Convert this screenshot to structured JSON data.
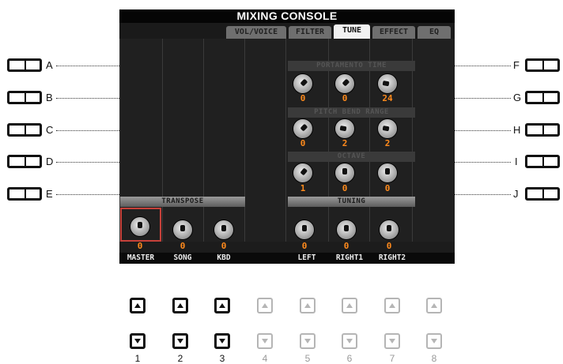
{
  "title": "MIXING CONSOLE",
  "tabs": [
    {
      "label": "VOL/VOICE",
      "active": false
    },
    {
      "label": "FILTER",
      "active": false
    },
    {
      "label": "TUNE",
      "active": true
    },
    {
      "label": "EFFECT",
      "active": false
    },
    {
      "label": "EQ",
      "active": false
    }
  ],
  "left_buttons": [
    {
      "label": "A"
    },
    {
      "label": "B"
    },
    {
      "label": "C"
    },
    {
      "label": "D"
    },
    {
      "label": "E"
    }
  ],
  "right_buttons": [
    {
      "label": "F"
    },
    {
      "label": "G"
    },
    {
      "label": "H"
    },
    {
      "label": "I"
    },
    {
      "label": "J"
    }
  ],
  "sections": {
    "transpose": "TRANSPOSE",
    "portamento": "PORTAMENTO TIME",
    "pitch_bend": "PITCH BEND RANGE",
    "octave": "OCTAVE",
    "tuning": "TUNING"
  },
  "transpose": {
    "master": "0",
    "song": "0",
    "kbd": "0"
  },
  "portamento": {
    "left": "0",
    "right1": "0",
    "right2": "24"
  },
  "pitch_bend": {
    "left": "0",
    "right1": "2",
    "right2": "2"
  },
  "octave": {
    "left": "1",
    "right1": "0",
    "right2": "0"
  },
  "tuning": {
    "left": "0",
    "right1": "0",
    "right2": "0"
  },
  "bottom_labels": [
    "MASTER",
    "SONG",
    "KBD",
    "",
    "LEFT",
    "RIGHT1",
    "RIGHT2",
    ""
  ],
  "number_buttons": [
    "1",
    "2",
    "3",
    "4",
    "5",
    "6",
    "7",
    "8"
  ],
  "colors": {
    "accent_value": "#ff8a1c",
    "selected_frame": "#c6413a"
  }
}
